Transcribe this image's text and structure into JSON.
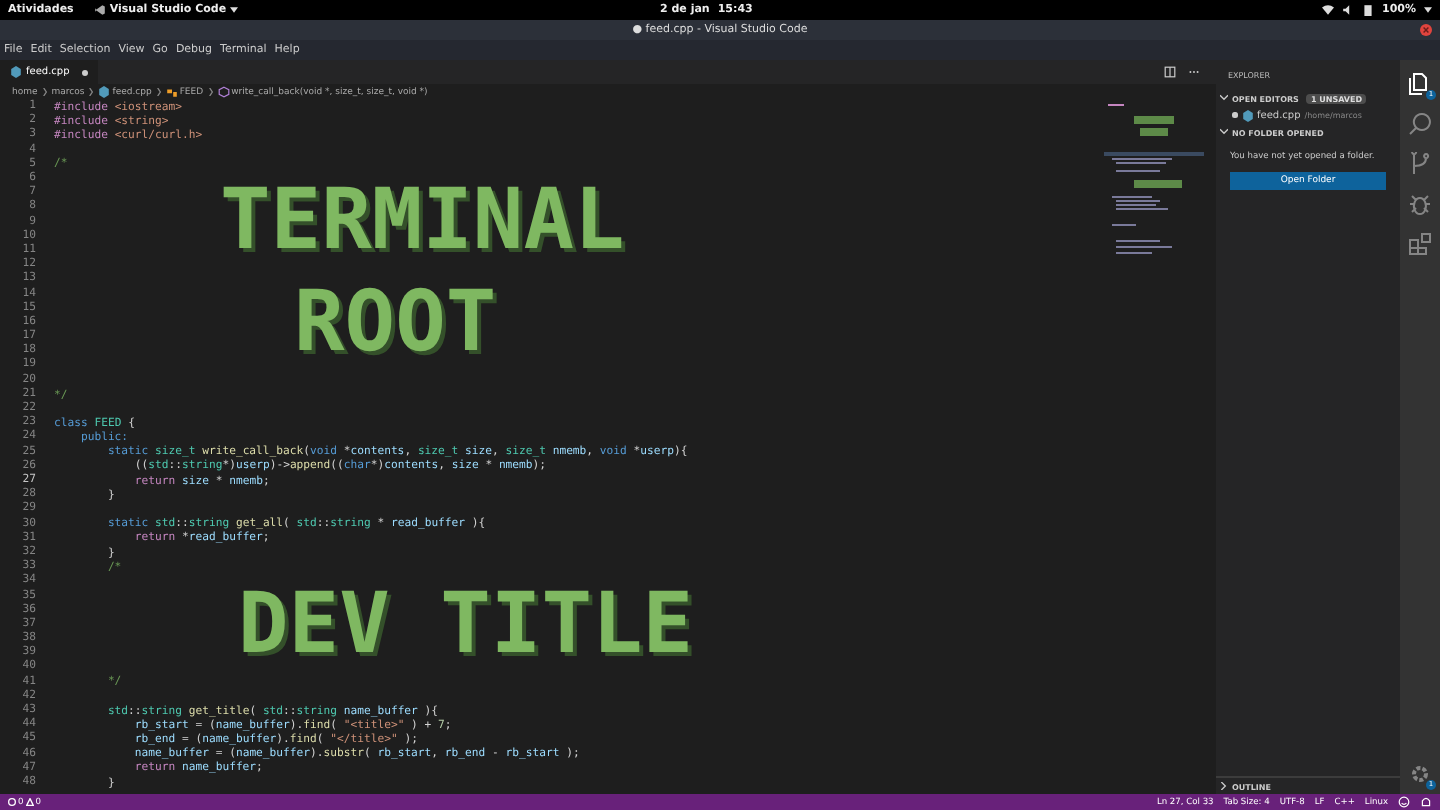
{
  "top_bar": {
    "activities": "Atividades",
    "app_menu": "Visual Studio Code",
    "date": "2 de jan",
    "time": "15:43",
    "battery": "100%"
  },
  "window": {
    "title": "● feed.cpp - Visual Studio Code"
  },
  "menu": [
    "File",
    "Edit",
    "Selection",
    "View",
    "Go",
    "Debug",
    "Terminal",
    "Help"
  ],
  "tabs": [
    {
      "label": "feed.cpp",
      "selected": true,
      "unsaved": true
    }
  ],
  "breadcrumb": [
    {
      "kind": "folder",
      "label": "home"
    },
    {
      "kind": "folder",
      "label": "marcos"
    },
    {
      "kind": "file",
      "label": "feed.cpp"
    },
    {
      "kind": "class",
      "label": "FEED"
    },
    {
      "kind": "method",
      "label": "write_call_back(void *, size_t, size_t, void *)"
    }
  ],
  "editor": {
    "lines": [
      {
        "kind": "code",
        "number": "1",
        "current": false,
        "tokens": [
          {
            "kind": "pre",
            "text": "#include "
          },
          {
            "kind": "str",
            "text": "<iostream>"
          }
        ]
      },
      {
        "kind": "code",
        "number": "2",
        "current": false,
        "tokens": [
          {
            "kind": "pre",
            "text": "#include "
          },
          {
            "kind": "str",
            "text": "<string>"
          }
        ]
      },
      {
        "kind": "code",
        "number": "3",
        "current": false,
        "tokens": [
          {
            "kind": "pre",
            "text": "#include "
          },
          {
            "kind": "str",
            "text": "<curl/curl.h>"
          }
        ]
      },
      {
        "kind": "code",
        "number": "4",
        "current": false
      },
      {
        "kind": "code",
        "number": "5",
        "current": false,
        "tokens": [
          {
            "kind": "cmt",
            "text": "/*"
          }
        ]
      },
      {
        "kind": "art",
        "numbers": [
          "6",
          "7",
          "8",
          "9",
          "10",
          "11",
          "12"
        ],
        "text": "TERMINAL"
      },
      {
        "kind": "art",
        "numbers": [
          "13",
          "14",
          "15",
          "16",
          "17",
          "18",
          "19"
        ],
        "text": "ROOT"
      },
      {
        "kind": "code",
        "number": "20",
        "current": false
      },
      {
        "kind": "code",
        "number": "21",
        "current": false,
        "tokens": [
          {
            "kind": "cmt",
            "text": "*/"
          }
        ]
      },
      {
        "kind": "code",
        "number": "22",
        "current": false
      },
      {
        "kind": "code",
        "number": "23",
        "current": false,
        "tokens": [
          {
            "kind": "kw",
            "text": "class "
          },
          {
            "kind": "type",
            "text": "FEED"
          },
          {
            "kind": "plain",
            "text": " {"
          }
        ]
      },
      {
        "kind": "code",
        "number": "24",
        "current": false,
        "tokens": [
          {
            "kind": "kw",
            "text": "    public:"
          }
        ]
      },
      {
        "kind": "code",
        "number": "25",
        "current": false,
        "tokens": [
          {
            "kind": "kw",
            "text": "        static "
          },
          {
            "kind": "type",
            "text": "size_t "
          },
          {
            "kind": "fn",
            "text": "write_call_back"
          },
          {
            "kind": "plain",
            "text": "("
          },
          {
            "kind": "kw",
            "text": "void "
          },
          {
            "kind": "plain",
            "text": "*"
          },
          {
            "kind": "var",
            "text": "contents"
          },
          {
            "kind": "plain",
            "text": ", "
          },
          {
            "kind": "type",
            "text": "size_t "
          },
          {
            "kind": "var",
            "text": "size"
          },
          {
            "kind": "plain",
            "text": ", "
          },
          {
            "kind": "type",
            "text": "size_t "
          },
          {
            "kind": "var",
            "text": "nmemb"
          },
          {
            "kind": "plain",
            "text": ", "
          },
          {
            "kind": "kw",
            "text": "void "
          },
          {
            "kind": "plain",
            "text": "*"
          },
          {
            "kind": "var",
            "text": "userp"
          },
          {
            "kind": "plain",
            "text": "){"
          }
        ]
      },
      {
        "kind": "code",
        "number": "26",
        "current": false,
        "tokens": [
          {
            "kind": "plain",
            "text": "            (("
          },
          {
            "kind": "type",
            "text": "std"
          },
          {
            "kind": "plain",
            "text": "::"
          },
          {
            "kind": "type",
            "text": "string"
          },
          {
            "kind": "plain",
            "text": "*)"
          },
          {
            "kind": "var",
            "text": "userp"
          },
          {
            "kind": "plain",
            "text": ")->"
          },
          {
            "kind": "fn",
            "text": "append"
          },
          {
            "kind": "plain",
            "text": "(("
          },
          {
            "kind": "kw",
            "text": "char"
          },
          {
            "kind": "plain",
            "text": "*)"
          },
          {
            "kind": "var",
            "text": "contents"
          },
          {
            "kind": "plain",
            "text": ", "
          },
          {
            "kind": "var",
            "text": "size"
          },
          {
            "kind": "plain",
            "text": " * "
          },
          {
            "kind": "var",
            "text": "nmemb"
          },
          {
            "kind": "plain",
            "text": ");"
          }
        ]
      },
      {
        "kind": "code",
        "number": "27",
        "current": true,
        "tokens": [
          {
            "kind": "ctrl",
            "text": "            return "
          },
          {
            "kind": "var",
            "text": "size"
          },
          {
            "kind": "plain",
            "text": " * "
          },
          {
            "kind": "var",
            "text": "nmemb"
          },
          {
            "kind": "plain",
            "text": ";"
          }
        ]
      },
      {
        "kind": "code",
        "number": "28",
        "current": false,
        "tokens": [
          {
            "kind": "plain",
            "text": "        }"
          }
        ]
      },
      {
        "kind": "code",
        "number": "29",
        "current": false
      },
      {
        "kind": "code",
        "number": "30",
        "current": false,
        "tokens": [
          {
            "kind": "kw",
            "text": "        static "
          },
          {
            "kind": "type",
            "text": "std"
          },
          {
            "kind": "plain",
            "text": "::"
          },
          {
            "kind": "type",
            "text": "string "
          },
          {
            "kind": "fn",
            "text": "get_all"
          },
          {
            "kind": "plain",
            "text": "( "
          },
          {
            "kind": "type",
            "text": "std"
          },
          {
            "kind": "plain",
            "text": "::"
          },
          {
            "kind": "type",
            "text": "string"
          },
          {
            "kind": "plain",
            "text": " * "
          },
          {
            "kind": "var",
            "text": "read_buffer"
          },
          {
            "kind": "plain",
            "text": " ){"
          }
        ]
      },
      {
        "kind": "code",
        "number": "31",
        "current": false,
        "tokens": [
          {
            "kind": "ctrl",
            "text": "            return "
          },
          {
            "kind": "plain",
            "text": "*"
          },
          {
            "kind": "var",
            "text": "read_buffer"
          },
          {
            "kind": "plain",
            "text": ";"
          }
        ]
      },
      {
        "kind": "code",
        "number": "32",
        "current": false,
        "tokens": [
          {
            "kind": "plain",
            "text": "        }"
          }
        ]
      },
      {
        "kind": "code",
        "number": "33",
        "current": false,
        "tokens": [
          {
            "kind": "cmt",
            "text": "        /*"
          }
        ]
      },
      {
        "kind": "art",
        "numbers": [
          "34",
          "35",
          "36",
          "37",
          "38",
          "39",
          "40"
        ],
        "text": "DEV TITLE"
      },
      {
        "kind": "code",
        "number": "41",
        "current": false,
        "tokens": [
          {
            "kind": "cmt",
            "text": "        */"
          }
        ]
      },
      {
        "kind": "code",
        "number": "42",
        "current": false
      },
      {
        "kind": "code",
        "number": "43",
        "current": false,
        "tokens": [
          {
            "kind": "type",
            "text": "        std"
          },
          {
            "kind": "plain",
            "text": "::"
          },
          {
            "kind": "type",
            "text": "string "
          },
          {
            "kind": "fn",
            "text": "get_title"
          },
          {
            "kind": "plain",
            "text": "( "
          },
          {
            "kind": "type",
            "text": "std"
          },
          {
            "kind": "plain",
            "text": "::"
          },
          {
            "kind": "type",
            "text": "string "
          },
          {
            "kind": "var",
            "text": "name_buffer"
          },
          {
            "kind": "plain",
            "text": " ){"
          }
        ]
      },
      {
        "kind": "code",
        "number": "44",
        "current": false,
        "tokens": [
          {
            "kind": "var",
            "text": "            rb_start"
          },
          {
            "kind": "plain",
            "text": " = ("
          },
          {
            "kind": "var",
            "text": "name_buffer"
          },
          {
            "kind": "plain",
            "text": ")."
          },
          {
            "kind": "fn",
            "text": "find"
          },
          {
            "kind": "plain",
            "text": "( "
          },
          {
            "kind": "str",
            "text": "\"<title>\""
          },
          {
            "kind": "plain",
            "text": " ) + "
          },
          {
            "kind": "num",
            "text": "7"
          },
          {
            "kind": "plain",
            "text": ";"
          }
        ]
      },
      {
        "kind": "code",
        "number": "45",
        "current": false,
        "tokens": [
          {
            "kind": "var",
            "text": "            rb_end"
          },
          {
            "kind": "plain",
            "text": " = ("
          },
          {
            "kind": "var",
            "text": "name_buffer"
          },
          {
            "kind": "plain",
            "text": ")."
          },
          {
            "kind": "fn",
            "text": "find"
          },
          {
            "kind": "plain",
            "text": "( "
          },
          {
            "kind": "str",
            "text": "\"</title>\""
          },
          {
            "kind": "plain",
            "text": " );"
          }
        ]
      },
      {
        "kind": "code",
        "number": "46",
        "current": false,
        "tokens": [
          {
            "kind": "var",
            "text": "            name_buffer"
          },
          {
            "kind": "plain",
            "text": " = ("
          },
          {
            "kind": "var",
            "text": "name_buffer"
          },
          {
            "kind": "plain",
            "text": ")."
          },
          {
            "kind": "fn",
            "text": "substr"
          },
          {
            "kind": "plain",
            "text": "( "
          },
          {
            "kind": "var",
            "text": "rb_start"
          },
          {
            "kind": "plain",
            "text": ", "
          },
          {
            "kind": "var",
            "text": "rb_end"
          },
          {
            "kind": "plain",
            "text": " - "
          },
          {
            "kind": "var",
            "text": "rb_start"
          },
          {
            "kind": "plain",
            "text": " );"
          }
        ]
      },
      {
        "kind": "code",
        "number": "47",
        "current": false,
        "tokens": [
          {
            "kind": "ctrl",
            "text": "            return "
          },
          {
            "kind": "var",
            "text": "name_buffer"
          },
          {
            "kind": "plain",
            "text": ";"
          }
        ]
      },
      {
        "kind": "code",
        "number": "48",
        "current": false,
        "tokens": [
          {
            "kind": "plain",
            "text": "        }"
          }
        ]
      }
    ]
  },
  "explorer": {
    "title": "EXPLORER",
    "open_editors": {
      "title": "OPEN EDITORS",
      "badge": "1 UNSAVED",
      "expanded": true,
      "files": [
        {
          "name": "feed.cpp",
          "path": "/home/marcos",
          "unsaved": true
        }
      ]
    },
    "no_folder": {
      "title": "NO FOLDER OPENED",
      "expanded": true,
      "message": "You have not yet opened a folder.",
      "button": "Open Folder"
    },
    "outline": {
      "title": "OUTLINE",
      "expanded": false
    }
  },
  "activity_bar": {
    "items": [
      {
        "kind": "files",
        "selected": true,
        "badge": "1"
      },
      {
        "kind": "search",
        "selected": false
      },
      {
        "kind": "source-control",
        "selected": false
      },
      {
        "kind": "debug",
        "selected": false
      },
      {
        "kind": "extensions",
        "selected": false
      }
    ],
    "settings_badge": "1"
  },
  "status_bar": {
    "errors": "0",
    "warnings": "0",
    "items": [
      "Ln 27, Col 33",
      "Tab Size: 4",
      "UTF-8",
      "LF",
      "C++",
      "Linux"
    ]
  }
}
